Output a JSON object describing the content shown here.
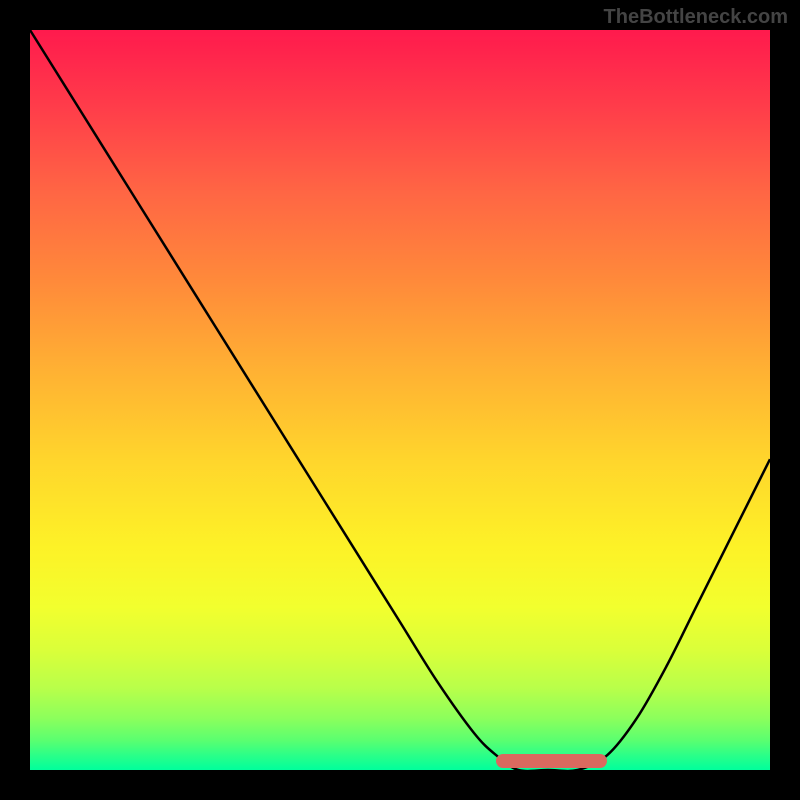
{
  "watermark": "TheBottleneck.com",
  "chart_data": {
    "type": "line",
    "title": "",
    "xlabel": "",
    "ylabel": "",
    "xlim": [
      0,
      100
    ],
    "ylim": [
      0,
      100
    ],
    "x": [
      0,
      5,
      10,
      15,
      20,
      25,
      30,
      35,
      40,
      45,
      50,
      55,
      60,
      63,
      66,
      70,
      74,
      78,
      82,
      86,
      90,
      95,
      100
    ],
    "values": [
      100,
      92,
      84,
      76,
      68,
      60,
      52,
      44,
      36,
      28,
      20,
      12,
      5,
      2,
      0,
      0,
      0,
      2,
      7,
      14,
      22,
      32,
      42
    ],
    "marker_range_x": [
      63,
      78
    ],
    "gradient_colors": {
      "top": "#ff1a4d",
      "mid": "#ffd52c",
      "bottom": "#00ff9c"
    },
    "marker_color": "#d9695f"
  }
}
